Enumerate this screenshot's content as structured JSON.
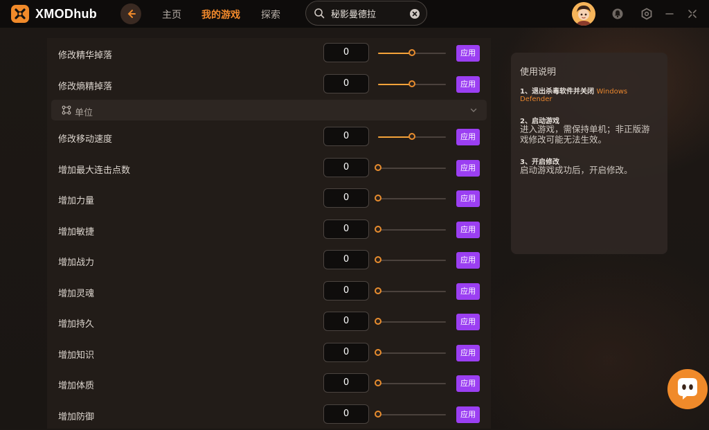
{
  "app": {
    "name": "XMODhub"
  },
  "nav": {
    "home": "主页",
    "my_games": "我的游戏",
    "explore": "探索"
  },
  "search": {
    "value": "秘影曼德拉"
  },
  "section": {
    "title": "单位"
  },
  "rows": [
    {
      "label": "修改精华掉落",
      "value": "0",
      "level": 0.5,
      "apply": "应用"
    },
    {
      "label": "修改熵精掉落",
      "value": "0",
      "level": 0.5,
      "apply": "应用"
    },
    {
      "label": "修改移动速度",
      "value": "0",
      "level": 0.5,
      "apply": "应用"
    },
    {
      "label": "增加最大连击点数",
      "value": "0",
      "level": 0,
      "apply": "应用"
    },
    {
      "label": "增加力量",
      "value": "0",
      "level": 0,
      "apply": "应用"
    },
    {
      "label": "增加敏捷",
      "value": "0",
      "level": 0,
      "apply": "应用"
    },
    {
      "label": "增加战力",
      "value": "0",
      "level": 0,
      "apply": "应用"
    },
    {
      "label": "增加灵魂",
      "value": "0",
      "level": 0,
      "apply": "应用"
    },
    {
      "label": "增加持久",
      "value": "0",
      "level": 0,
      "apply": "应用"
    },
    {
      "label": "增加知识",
      "value": "0",
      "level": 0,
      "apply": "应用"
    },
    {
      "label": "增加体质",
      "value": "0",
      "level": 0,
      "apply": "应用"
    },
    {
      "label": "增加防御",
      "value": "0",
      "level": 0,
      "apply": "应用"
    }
  ],
  "instructions": {
    "title": "使用说明",
    "step1_head": "1、退出杀毒软件并关闭",
    "step1_accent1": "Windows",
    "step1_accent2": "Defender",
    "step2_head": "2、启动游戏",
    "step2_line1": "进入游戏，需保持单机；非正版游",
    "step2_line2": "戏修改可能无法生效。",
    "step3_head": "3、开启修改",
    "step3_text": "启动游戏成功后，开启修改。"
  },
  "colors": {
    "accent": "#f38a2c",
    "apply": "#9b3ff2",
    "slider": "#f5a33a"
  },
  "icons": [
    "xmod-logo-icon",
    "back-arrow-icon",
    "search-icon",
    "clear-icon",
    "avatar",
    "notification-icon",
    "settings-icon",
    "minimize-icon",
    "close-icon",
    "unit-icon",
    "chevron-down-icon",
    "assistant-bot-icon"
  ]
}
